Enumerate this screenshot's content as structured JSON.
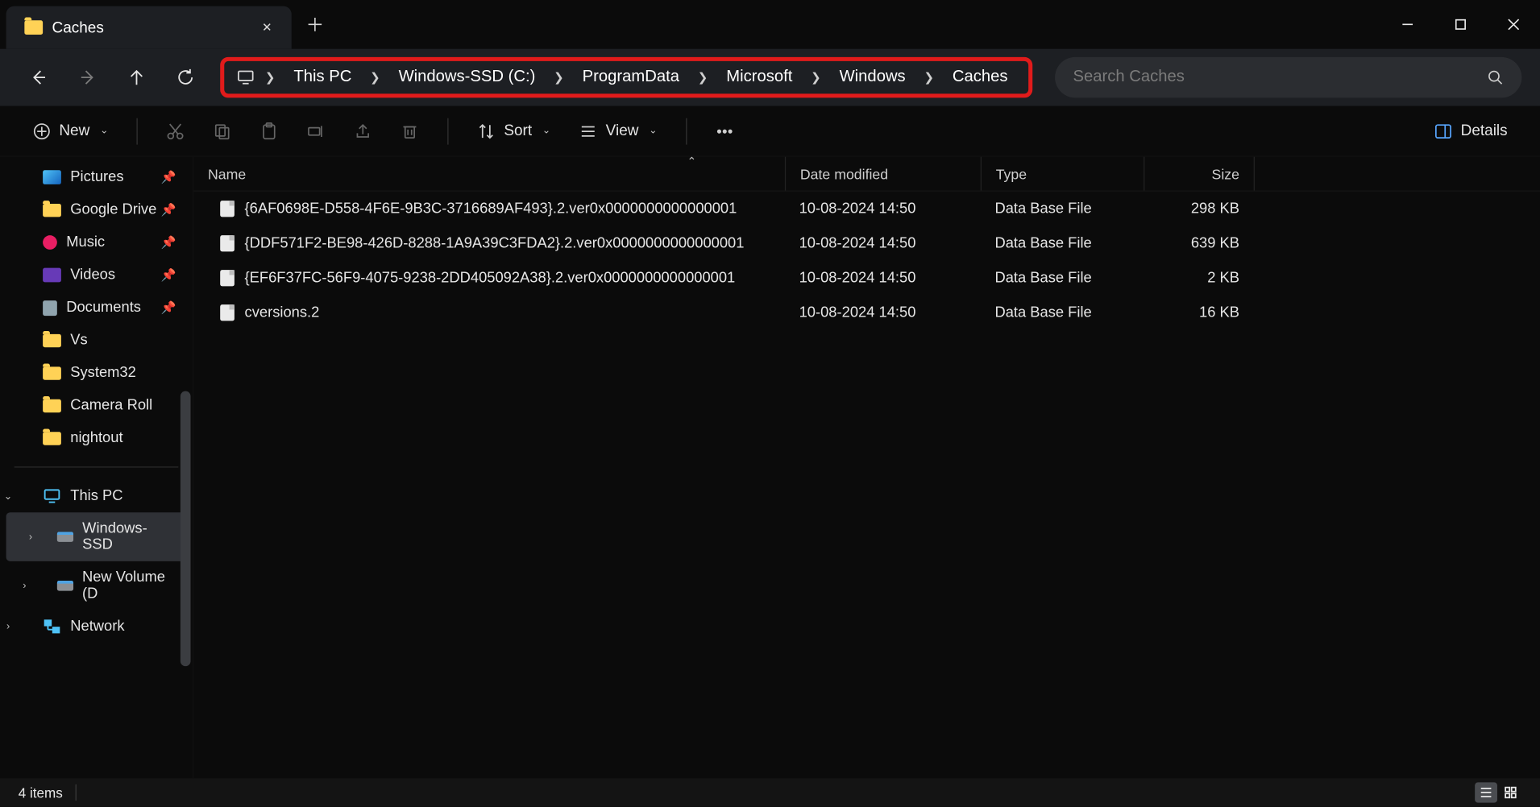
{
  "tab": {
    "title": "Caches"
  },
  "breadcrumb": {
    "items": [
      {
        "label": "This PC"
      },
      {
        "label": "Windows-SSD (C:)"
      },
      {
        "label": "ProgramData"
      },
      {
        "label": "Microsoft"
      },
      {
        "label": "Windows"
      },
      {
        "label": "Caches"
      }
    ]
  },
  "search": {
    "placeholder": "Search Caches"
  },
  "toolbar": {
    "new_label": "New",
    "sort_label": "Sort",
    "view_label": "View",
    "details_label": "Details"
  },
  "sidebar": {
    "quick": [
      {
        "label": "Pictures",
        "icon": "pic",
        "pinned": true
      },
      {
        "label": "Google Drive",
        "icon": "folder",
        "pinned": true
      },
      {
        "label": "Music",
        "icon": "music",
        "pinned": true
      },
      {
        "label": "Videos",
        "icon": "video",
        "pinned": true
      },
      {
        "label": "Documents",
        "icon": "doc",
        "pinned": true
      },
      {
        "label": "Vs",
        "icon": "folder",
        "pinned": false
      },
      {
        "label": "System32",
        "icon": "folder",
        "pinned": false
      },
      {
        "label": "Camera Roll",
        "icon": "folder",
        "pinned": false
      },
      {
        "label": "nightout",
        "icon": "folder",
        "pinned": false
      }
    ],
    "this_pc_label": "This PC",
    "drives": [
      {
        "label": "Windows-SSD",
        "selected": true
      },
      {
        "label": "New Volume (D",
        "selected": false
      }
    ],
    "network_label": "Network"
  },
  "columns": {
    "name": "Name",
    "date": "Date modified",
    "type": "Type",
    "size": "Size"
  },
  "files": [
    {
      "name": "{6AF0698E-D558-4F6E-9B3C-3716689AF493}.2.ver0x0000000000000001",
      "date": "10-08-2024 14:50",
      "type": "Data Base File",
      "size": "298 KB"
    },
    {
      "name": "{DDF571F2-BE98-426D-8288-1A9A39C3FDA2}.2.ver0x0000000000000001",
      "date": "10-08-2024 14:50",
      "type": "Data Base File",
      "size": "639 KB"
    },
    {
      "name": "{EF6F37FC-56F9-4075-9238-2DD405092A38}.2.ver0x0000000000000001",
      "date": "10-08-2024 14:50",
      "type": "Data Base File",
      "size": "2 KB"
    },
    {
      "name": "cversions.2",
      "date": "10-08-2024 14:50",
      "type": "Data Base File",
      "size": "16 KB"
    }
  ],
  "status": {
    "item_count": "4 items"
  },
  "highlight_color": "#e11b1b"
}
